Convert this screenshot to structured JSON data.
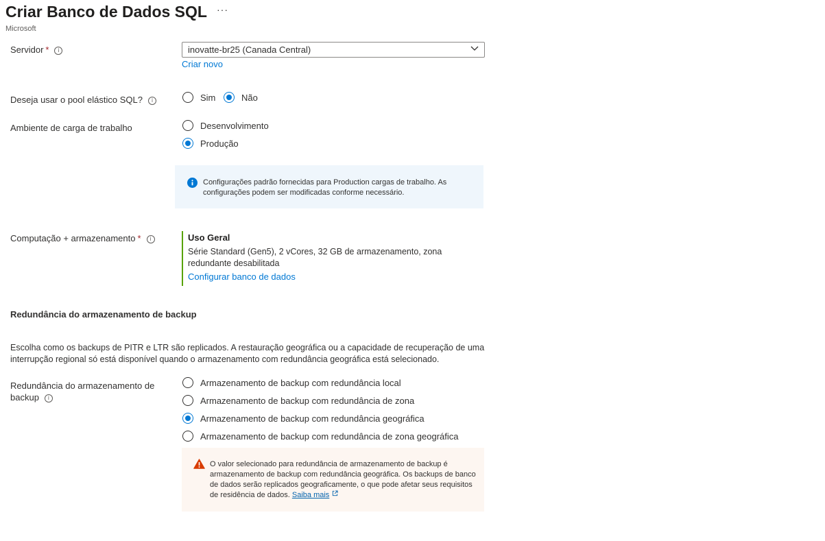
{
  "header": {
    "title": "Criar Banco de Dados SQL",
    "more_label": "···",
    "subtitle": "Microsoft"
  },
  "server": {
    "label": "Servidor",
    "required_marker": "*",
    "value": "inovatte-br25 (Canada Central)",
    "create_new": "Criar novo"
  },
  "elastic_pool": {
    "label": "Deseja usar o pool elástico SQL?",
    "options": [
      {
        "label": "Sim",
        "checked": false
      },
      {
        "label": "Não",
        "checked": true
      }
    ]
  },
  "workload": {
    "label": "Ambiente de carga de trabalho",
    "options": [
      {
        "label": "Desenvolvimento",
        "checked": false
      },
      {
        "label": "Produção",
        "checked": true
      }
    ],
    "info": "Configurações padrão fornecidas para Production cargas de trabalho. As configurações podem ser modificadas conforme necessário."
  },
  "compute": {
    "label": "Computação + armazenamento",
    "required_marker": "*",
    "tier": "Uso Geral",
    "description": "Série Standard (Gen5), 2 vCores, 32 GB de armazenamento, zona redundante desabilitada",
    "configure_link": "Configurar banco de dados"
  },
  "backup": {
    "section_title": "Redundância do armazenamento de backup",
    "description": "Escolha como os backups de PITR e LTR são replicados. A restauração geográfica ou a capacidade de recuperação de uma interrupção regional só está disponível quando o armazenamento com redundância geográfica está selecionado.",
    "label_line1": "Redundância do armazenamento de",
    "label_line2": "backup",
    "options": [
      {
        "label": "Armazenamento de backup com redundância local",
        "checked": false
      },
      {
        "label": "Armazenamento de backup com redundância de zona",
        "checked": false
      },
      {
        "label": "Armazenamento de backup com redundância geográfica",
        "checked": true
      },
      {
        "label": "Armazenamento de backup com redundância de zona geográfica",
        "checked": false
      }
    ],
    "warning": "O valor selecionado para redundância de armazenamento de backup é armazenamento de backup com redundância geográfica. Os backups de banco de dados serão replicados geograficamente, o que pode afetar seus requisitos de residência de dados.",
    "learn_more": "Saiba mais"
  },
  "colors": {
    "accent": "#0078d4",
    "required": "#a4262c",
    "compute_border": "#57a300",
    "info_bg": "#eff6fc",
    "warning_bg": "#fdf6f1",
    "warning_icon": "#d83b01"
  }
}
